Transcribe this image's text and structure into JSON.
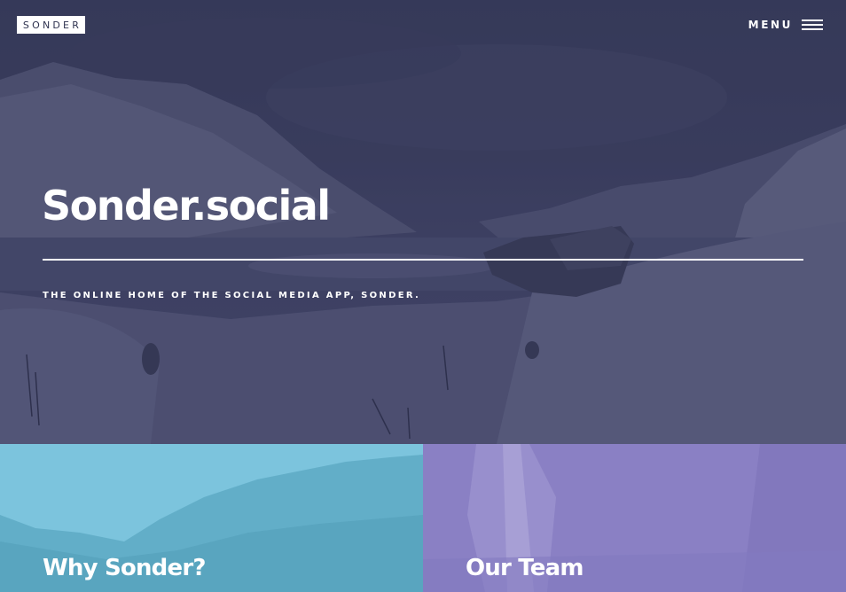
{
  "header": {
    "logo_text": "SONDER",
    "menu_label": "MENU",
    "menu_icon": "hamburger-icon"
  },
  "hero": {
    "title": "Sonder.social",
    "subtitle": "THE ONLINE HOME OF THE SOCIAL MEDIA APP, SONDER."
  },
  "tiles": [
    {
      "title": "Why Sonder?",
      "color": "#7cc4dd"
    },
    {
      "title": "Our Team",
      "color": "#8a80c4"
    }
  ],
  "colors": {
    "hero_tint": "#3a3e5c",
    "text": "#ffffff"
  }
}
